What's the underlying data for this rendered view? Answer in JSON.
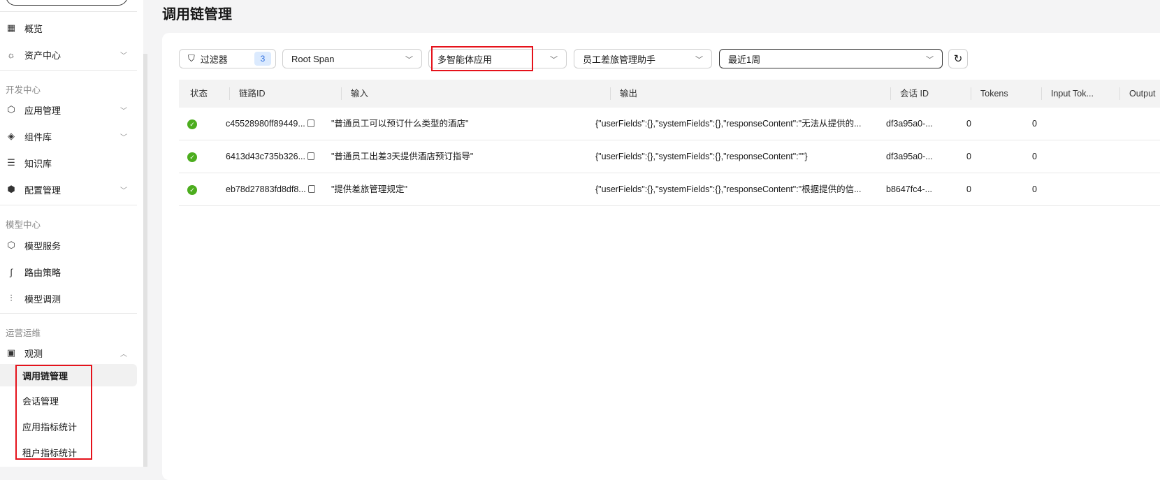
{
  "page_title": "调用链管理",
  "sidebar": {
    "items": [
      {
        "label": "概览",
        "icon": "grid-icon"
      },
      {
        "label": "资产中心",
        "icon": "bulb-icon",
        "expandable": true
      }
    ],
    "groups": [
      {
        "label": "开发中心",
        "items": [
          {
            "label": "应用管理",
            "icon": "cube-icon",
            "expandable": true
          },
          {
            "label": "组件库",
            "icon": "layers-icon",
            "expandable": true
          },
          {
            "label": "知识库",
            "icon": "database-icon"
          },
          {
            "label": "配置管理",
            "icon": "settings-hex-icon",
            "expandable": true
          }
        ]
      },
      {
        "label": "模型中心",
        "items": [
          {
            "label": "模型服务",
            "icon": "model-hex-icon"
          },
          {
            "label": "路由策略",
            "icon": "route-icon"
          },
          {
            "label": "模型调测",
            "icon": "sliders-icon"
          }
        ]
      },
      {
        "label": "运营运维",
        "items": [
          {
            "label": "观测",
            "icon": "monitor-icon",
            "expanded": true
          }
        ]
      }
    ],
    "sub_items": [
      {
        "label": "调用链管理",
        "active": true
      },
      {
        "label": "会话管理"
      },
      {
        "label": "应用指标统计"
      },
      {
        "label": "租户指标统计"
      }
    ]
  },
  "filters": {
    "filter_label": "过滤器",
    "filter_count": "3",
    "span_type": "Root Span",
    "app_type": "多智能体应用",
    "app_name": "员工差旅管理助手",
    "time_range": "最近1周"
  },
  "table": {
    "columns": [
      "状态",
      "链路ID",
      "输入",
      "输出",
      "会话 ID",
      "Tokens",
      "Input Tok...",
      "Output"
    ],
    "rows": [
      {
        "status": "success",
        "trace_id": "c45528980ff89449...",
        "input": "\"普通员工可以预订什么类型的酒店\"",
        "output": "{\"userFields\":{},\"systemFields\":{},\"responseContent\":\"无法从提供的...",
        "session_id": "df3a95a0-...",
        "tokens": "0",
        "input_tokens": "0"
      },
      {
        "status": "success",
        "trace_id": "6413d43c735b326...",
        "input": "\"普通员工出差3天提供酒店预订指导\"",
        "output": "{\"userFields\":{},\"systemFields\":{},\"responseContent\":\"\"}",
        "session_id": "df3a95a0-...",
        "tokens": "0",
        "input_tokens": "0"
      },
      {
        "status": "success",
        "trace_id": "eb78d27883fd8df8...",
        "input": "\"提供差旅管理规定\"",
        "output": "{\"userFields\":{},\"systemFields\":{},\"responseContent\":\"根据提供的信...",
        "session_id": "b8647fc4-...",
        "tokens": "0",
        "input_tokens": "0"
      }
    ]
  },
  "colors": {
    "highlight_box": "#e5121b",
    "success": "#4cad1e",
    "badge": "#2f6fe0"
  }
}
